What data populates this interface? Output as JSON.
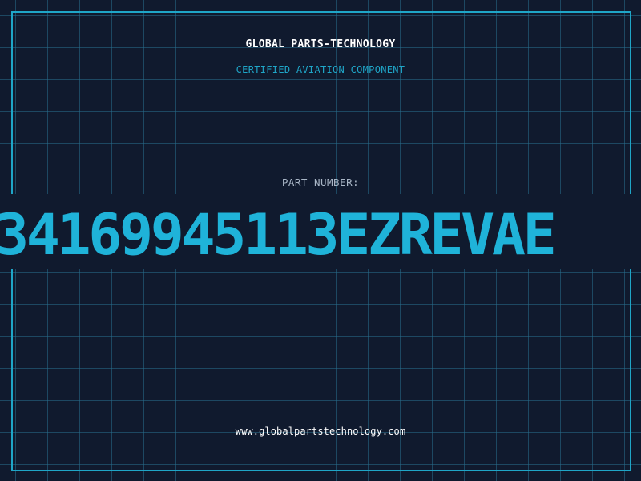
{
  "header": {
    "company": "GLOBAL PARTS-TECHNOLOGY",
    "subtitle": "CERTIFIED AVIATION COMPONENT"
  },
  "part": {
    "label": "PART NUMBER:",
    "number": "34169945113EZREVAE"
  },
  "footer": {
    "url": "www.globalpartstechnology.com"
  },
  "colors": {
    "background": "#101a2e",
    "grid": "#286e8c",
    "accent": "#1fa6c8",
    "part_number": "#1fb3d9",
    "title": "#ffffff",
    "label": "#a9b6c6"
  }
}
